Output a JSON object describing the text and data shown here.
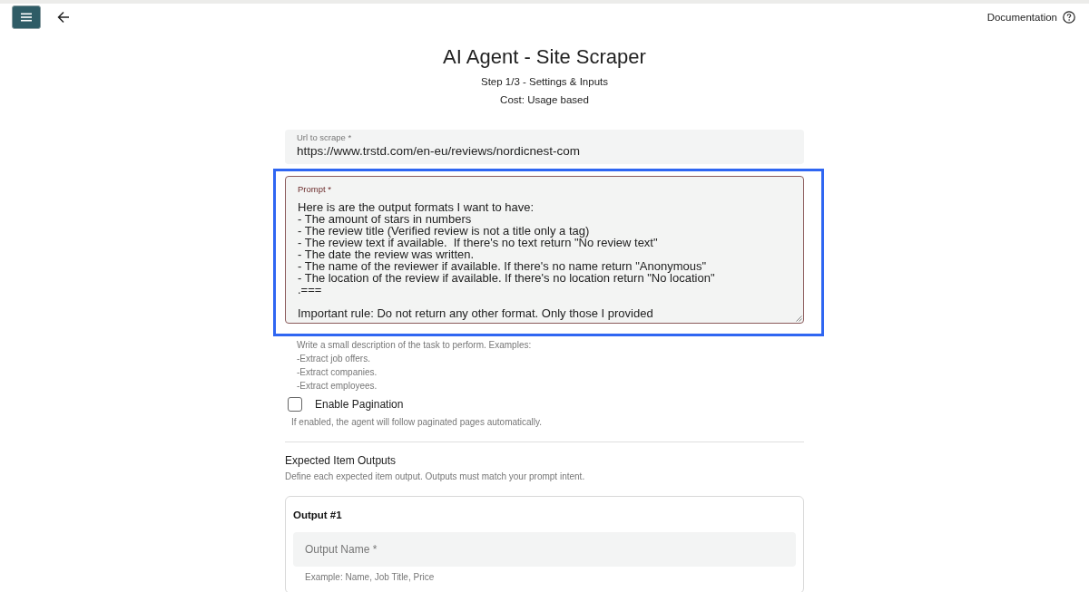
{
  "top_bar": {
    "documentation_link": "Documentation"
  },
  "header": {
    "title": "AI Agent - Site Scraper",
    "step": "Step 1/3 - Settings & Inputs",
    "cost": "Cost: Usage based"
  },
  "form": {
    "url_field": {
      "label": "Url to scrape *",
      "value": "https://www.trstd.com/en-eu/reviews/nordicnest-com"
    },
    "prompt_field": {
      "label": "Prompt *",
      "value": "Here is are the output formats I want to have:\n- The amount of stars in numbers\n- The review title (Verified review is not a title only a tag)\n- The review text if available.  If there's no text return \"No review text\"\n- The date the review was written.\n- The name of the reviewer if available. If there's no name return \"Anonymous\"\n- The location of the review if available. If there's no location return \"No location\"\n.===\n\nImportant rule: Do not return any other format. Only those I provided",
      "focused": true,
      "highlighted": true,
      "helper_lines": [
        "Write a small description of the task to perform. Examples:",
        "-Extract job offers.",
        "-Extract companies.",
        "-Extract employees."
      ]
    },
    "pagination": {
      "label": "Enable Pagination",
      "checked": false,
      "helper": "If enabled, the agent will follow paginated pages automatically."
    },
    "outputs_section": {
      "title": "Expected Item Outputs",
      "description": "Define each expected item output. Outputs must match your prompt intent.",
      "outputs": [
        {
          "title": "Output #1",
          "name_field": {
            "placeholder": "Output Name *",
            "helper": "Example: Name, Job Title, Price"
          }
        }
      ]
    }
  }
}
